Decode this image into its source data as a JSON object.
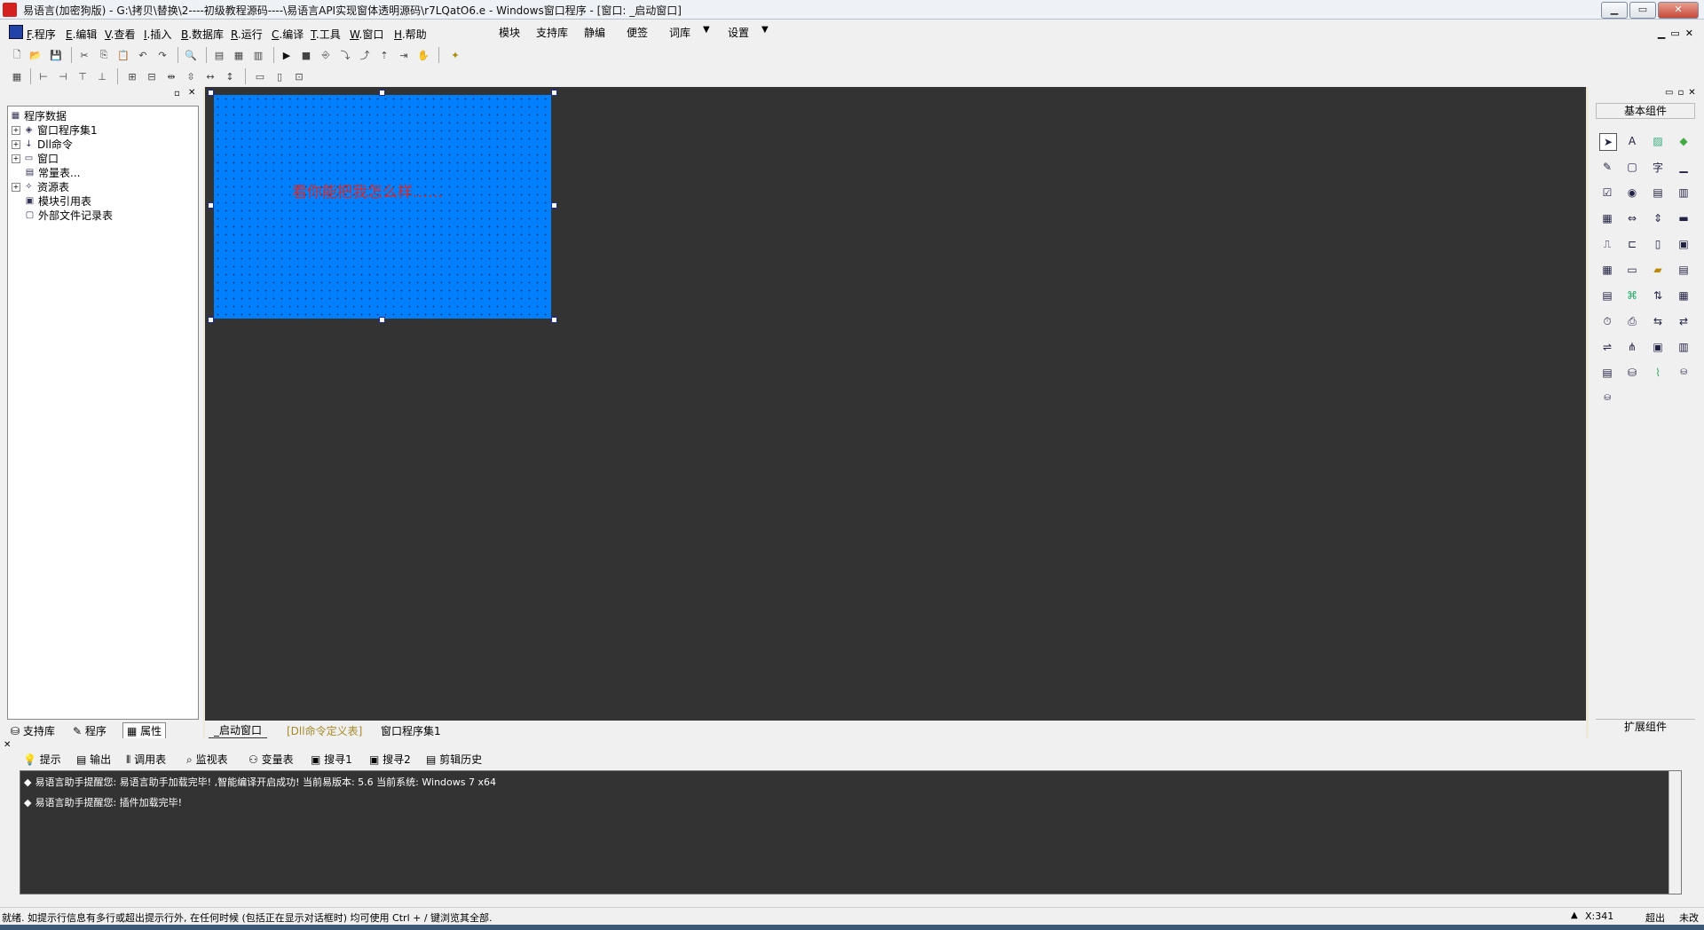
{
  "window": {
    "title": "易语言(加密狗版) - G:\\拷贝\\替换\\2----初级教程源码----\\易语言API实现窗体透明源码\\r7LQatO6.e - Windows窗口程序 - [窗口: _启动窗口]",
    "minimize": "▁",
    "maximize": "▭",
    "close": "✕"
  },
  "menu": {
    "items": [
      {
        "key": "F",
        "label": ".程序"
      },
      {
        "key": "E",
        "label": ".编辑"
      },
      {
        "key": "V",
        "label": ".查看"
      },
      {
        "key": "I",
        "label": ".插入"
      },
      {
        "key": "B",
        "label": ".数据库"
      },
      {
        "key": "R",
        "label": ".运行"
      },
      {
        "key": "C",
        "label": ".编译"
      },
      {
        "key": "T",
        "label": ".工具"
      },
      {
        "key": "W",
        "label": ".窗口"
      },
      {
        "key": "H",
        "label": ".帮助"
      }
    ],
    "extra": [
      "模块",
      "支持库",
      "静编",
      "便签",
      "词库",
      "设置"
    ],
    "dropdown": "▼"
  },
  "tree": {
    "root": "程序数据",
    "items": [
      "窗口程序集1",
      "Dll命令",
      "窗口",
      "常量表...",
      "资源表",
      "模块引用表",
      "外部文件记录表"
    ]
  },
  "left_tabs": [
    "支持库",
    "程序",
    "属性"
  ],
  "form": {
    "text": "看你能把我怎么样……",
    "bg_color": "#0080ff",
    "text_color": "#d62a2a"
  },
  "editor_tabs": [
    "_启动窗口",
    "[Dll命令定义表]",
    "窗口程序集1"
  ],
  "components": {
    "header": "基本组件",
    "footer": "扩展组件"
  },
  "bottom_tabs": [
    "提示",
    "输出",
    "调用表",
    "监视表",
    "变量表",
    "搜寻1",
    "搜寻2",
    "剪辑历史"
  ],
  "output": {
    "lines": [
      "易语言助手提醒您: 易语言助手加载完毕! ,智能编译开启成功! 当前易版本: 5.6 当前系统: Windows 7 x64",
      "易语言助手提醒您: 插件加载完毕!"
    ]
  },
  "status": {
    "message": "就绪. 如提示行信息有多行或超出提示行外, 在任何时候 (包括正在显示对话框时) 均可使用 Ctrl + / 键浏览其全部.",
    "coord": "X:341",
    "mode1": "超出",
    "mode2": "未改"
  }
}
